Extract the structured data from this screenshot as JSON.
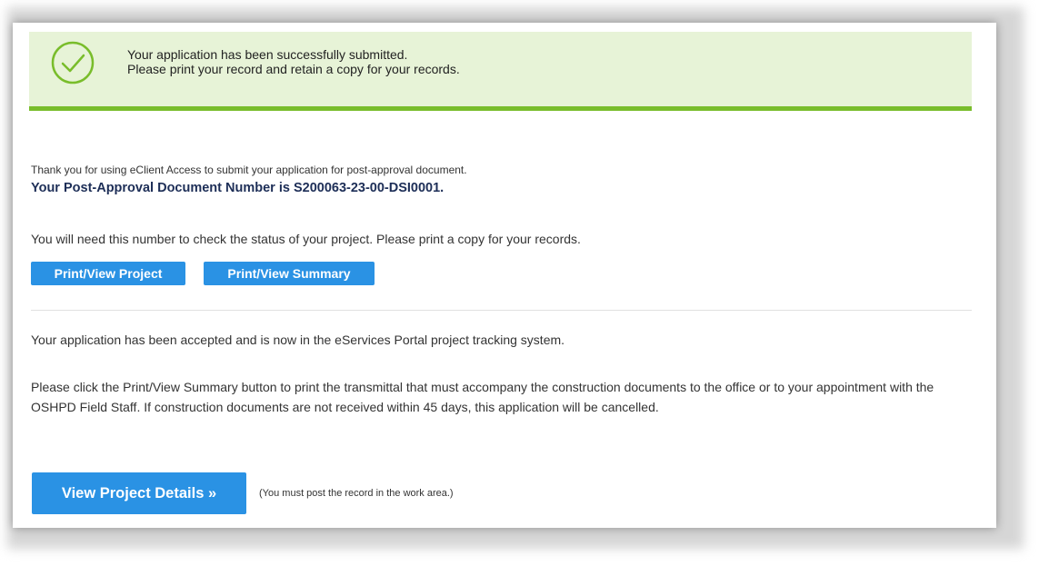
{
  "banner": {
    "line1": "Your application has been successfully submitted.",
    "line2": "Please print your record and retain a copy for your records.",
    "icon": "check-circle-icon",
    "color_bg": "#e7f3d7",
    "color_accent": "#79bd2b"
  },
  "content": {
    "thanks": "Thank you for using eClient Access to submit your application for post-approval document.",
    "doc_number": "Your Post-Approval Document Number is S200063-23-00-DSI0001.",
    "need_number": "You will need this number to check the status of your project. Please print a copy for your records.",
    "accepted": "Your application has been accepted and is now in the eServices Portal project tracking system.",
    "instructions": "Please click the Print/View Summary button to print the transmittal that must accompany the construction documents to the office or to your appointment with the OSHPD Field Staff.  If construction documents are not received within 45 days, this application will be cancelled.",
    "post_note": "(You must post the record in the work area.)"
  },
  "buttons": {
    "print_project": "Print/View Project",
    "print_summary": "Print/View Summary",
    "view_details": "View Project Details »",
    "color": "#2a92e4"
  },
  "colors": {
    "doc_number": "#1d2e57",
    "text": "#333333"
  }
}
